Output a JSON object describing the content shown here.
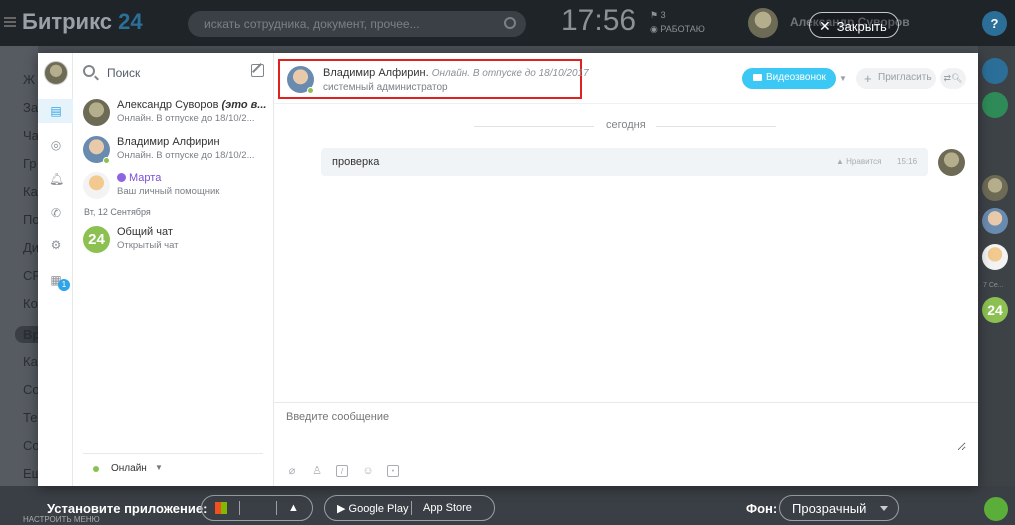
{
  "portal": {
    "logo_name": "Битрикс",
    "logo_num": "24",
    "search_placeholder": "искать сотрудника, документ, прочее...",
    "clock": "17:56",
    "flag_count": "3",
    "work_status": "РАБОТАЮ",
    "user_name": "Александр Суворов",
    "close_label": "Закрыть",
    "help": "?",
    "left_items": [
      "Ж",
      "За",
      "Ча",
      "Гр",
      "Ка",
      "По",
      "Ди",
      "CR",
      "Ко",
      "Вр",
      "Ка",
      "Со",
      "Те",
      "Со",
      "Ещ"
    ],
    "install_label": "Установите приложение:",
    "google_play": "Google Play",
    "app_store": "App Store",
    "background_label": "Фон:",
    "background_value": "Прозрачный",
    "settings_menu": "НАСТРОИТЬ МЕНЮ",
    "right_date": "7 Се..."
  },
  "messenger": {
    "search_placeholder": "Поиск",
    "recent": [
      {
        "name_plain": "Александр Суворов ",
        "name_em": "(это в...",
        "status": "Онлайн. В отпуске до 18/10/2..."
      },
      {
        "name_plain": "Владимир Алфирин",
        "name_em": "",
        "status": "Онлайн. В отпуске до 18/10/2..."
      },
      {
        "name_plain": "Марта",
        "name_em": "",
        "status": "Ваш личный помощник"
      }
    ],
    "date_separator": "Вт, 12 Сентября",
    "group_chat": {
      "avatar_text": "24",
      "name": "Общий чат",
      "status": "Открытый чат"
    },
    "online_status": "Онлайн",
    "rail_badge": "1",
    "dialog": {
      "name": "Владимир Алфирин",
      "status": "Онлайн. В отпуске до 18/10/2017",
      "position": "системный администратор",
      "video_call": "Видеозвонок",
      "invite": "Пригласить",
      "day_separator": "сегодня",
      "message_text": "проверка",
      "like_label": "Нравится",
      "message_time": "15:16",
      "input_placeholder": "Введите сообщение"
    }
  }
}
